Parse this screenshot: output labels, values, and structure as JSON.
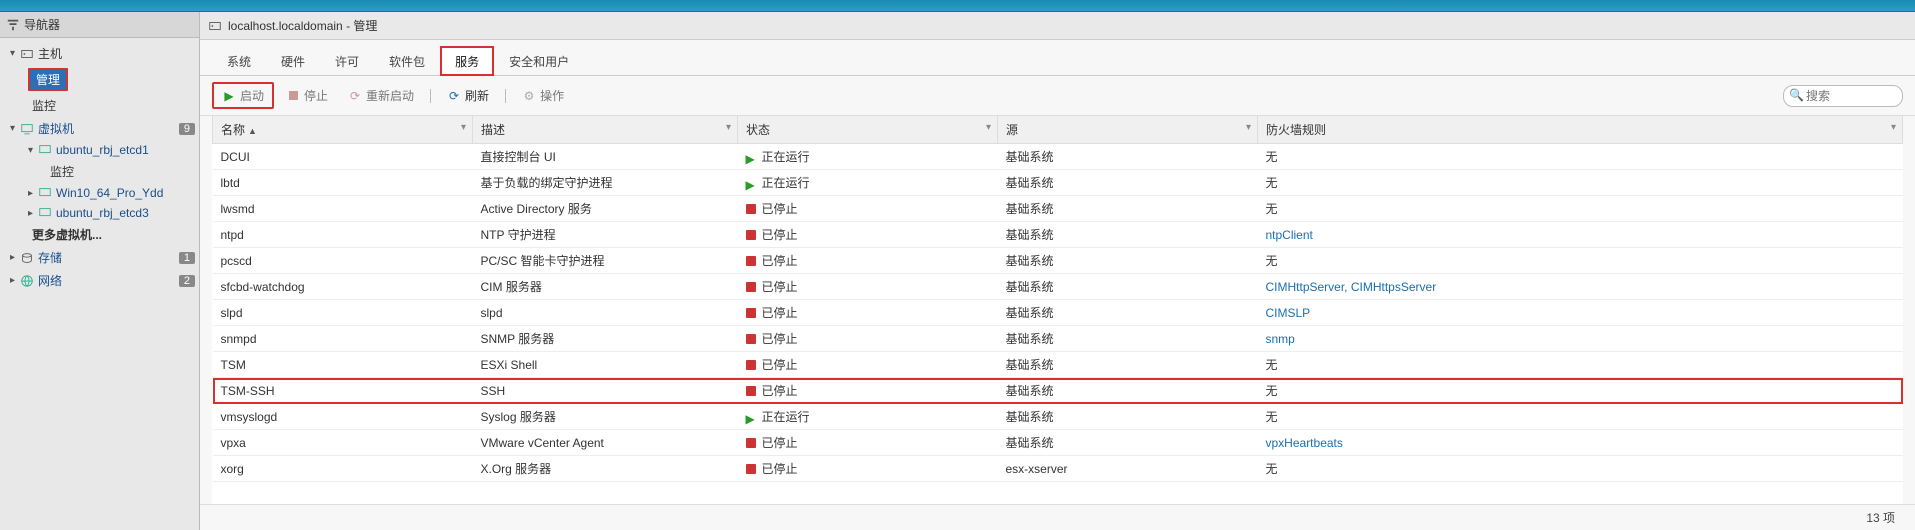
{
  "sidebar": {
    "title": "导航器",
    "host_label": "主机",
    "manage": "管理",
    "monitor": "监控",
    "vms_label": "虚拟机",
    "vms_count": "9",
    "vm1": "ubuntu_rbj_etcd1",
    "vm1_monitor": "监控",
    "vm2": "Win10_64_Pro_Ydd",
    "vm3": "ubuntu_rbj_etcd3",
    "more_vms": "更多虚拟机...",
    "storage_label": "存储",
    "storage_count": "1",
    "network_label": "网络",
    "network_count": "2"
  },
  "header": {
    "title": "localhost.localdomain - 管理"
  },
  "tabs": {
    "t0": "系统",
    "t1": "硬件",
    "t2": "许可",
    "t3": "软件包",
    "t4": "服务",
    "t5": "安全和用户"
  },
  "toolbar": {
    "start": "启动",
    "stop": "停止",
    "restart": "重新启动",
    "refresh": "刷新",
    "actions": "操作",
    "search_placeholder": "搜索"
  },
  "columns": {
    "name": "名称",
    "desc": "描述",
    "status": "状态",
    "source": "源",
    "firewall": "防火墙规则"
  },
  "status_labels": {
    "running": "正在运行",
    "stopped": "已停止"
  },
  "source_labels": {
    "base": "基础系统",
    "esx": "esx-xserver"
  },
  "rows": [
    {
      "name": "DCUI",
      "desc": "直接控制台 UI",
      "status": "running",
      "source": "base",
      "fw": "无",
      "fw_link": false
    },
    {
      "name": "lbtd",
      "desc": "基于负载的绑定守护进程",
      "status": "running",
      "source": "base",
      "fw": "无",
      "fw_link": false
    },
    {
      "name": "lwsmd",
      "desc": "Active Directory 服务",
      "status": "stopped",
      "source": "base",
      "fw": "无",
      "fw_link": false
    },
    {
      "name": "ntpd",
      "desc": "NTP 守护进程",
      "status": "stopped",
      "source": "base",
      "fw": "ntpClient",
      "fw_link": true
    },
    {
      "name": "pcscd",
      "desc": "PC/SC 智能卡守护进程",
      "status": "stopped",
      "source": "base",
      "fw": "无",
      "fw_link": false
    },
    {
      "name": "sfcbd-watchdog",
      "desc": "CIM 服务器",
      "status": "stopped",
      "source": "base",
      "fw": "CIMHttpServer, CIMHttpsServer",
      "fw_link": true
    },
    {
      "name": "slpd",
      "desc": "slpd",
      "status": "stopped",
      "source": "base",
      "fw": "CIMSLP",
      "fw_link": true
    },
    {
      "name": "snmpd",
      "desc": "SNMP 服务器",
      "status": "stopped",
      "source": "base",
      "fw": "snmp",
      "fw_link": true
    },
    {
      "name": "TSM",
      "desc": "ESXi Shell",
      "status": "stopped",
      "source": "base",
      "fw": "无",
      "fw_link": false
    },
    {
      "name": "TSM-SSH",
      "desc": "SSH",
      "status": "stopped",
      "source": "base",
      "fw": "无",
      "fw_link": false,
      "hl": true
    },
    {
      "name": "vmsyslogd",
      "desc": "Syslog 服务器",
      "status": "running",
      "source": "base",
      "fw": "无",
      "fw_link": false
    },
    {
      "name": "vpxa",
      "desc": "VMware vCenter Agent",
      "status": "stopped",
      "source": "base",
      "fw": "vpxHeartbeats",
      "fw_link": true
    },
    {
      "name": "xorg",
      "desc": "X.Org 服务器",
      "status": "stopped",
      "source": "esx",
      "fw": "无",
      "fw_link": false
    }
  ],
  "footer": {
    "count": "13 项"
  }
}
